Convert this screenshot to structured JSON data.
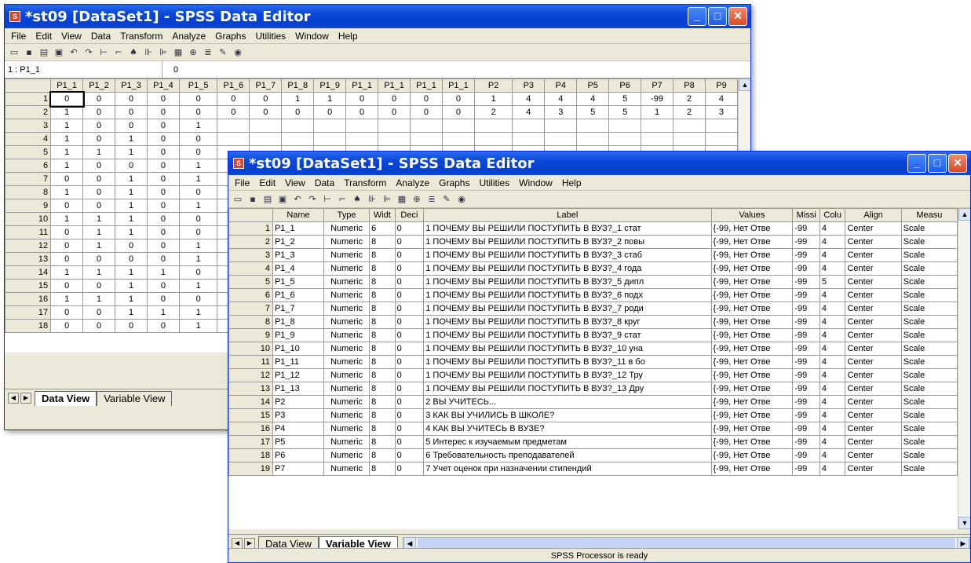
{
  "w1": {
    "title": "*st09 [DataSet1] - SPSS Data Editor",
    "menu": [
      "File",
      "Edit",
      "View",
      "Data",
      "Transform",
      "Analyze",
      "Graphs",
      "Utilities",
      "Window",
      "Help"
    ],
    "cell_ref": "1 : P1_1",
    "cell_value": "0",
    "columns": [
      "P1_1",
      "P1_2",
      "P1_3",
      "P1_4",
      "P1_5",
      "P1_6",
      "P1_7",
      "P1_8",
      "P1_9",
      "P1_1",
      "P1_1",
      "P1_1",
      "P1_1",
      "P2",
      "P3",
      "P4",
      "P5",
      "P6",
      "P7",
      "P8",
      "P9"
    ],
    "rows": [
      [
        "0",
        "0",
        "0",
        "0",
        "0",
        "0",
        "0",
        "1",
        "1",
        "0",
        "0",
        "0",
        "0",
        "1",
        "4",
        "4",
        "4",
        "5",
        "-99",
        "2",
        "4"
      ],
      [
        "1",
        "0",
        "0",
        "0",
        "0",
        "0",
        "0",
        "0",
        "0",
        "0",
        "0",
        "0",
        "0",
        "2",
        "4",
        "3",
        "5",
        "5",
        "1",
        "2",
        "3"
      ],
      [
        "1",
        "0",
        "0",
        "0",
        "1"
      ],
      [
        "1",
        "0",
        "1",
        "0",
        "0"
      ],
      [
        "1",
        "1",
        "1",
        "0",
        "0"
      ],
      [
        "1",
        "0",
        "0",
        "0",
        "1"
      ],
      [
        "0",
        "0",
        "1",
        "0",
        "1"
      ],
      [
        "1",
        "0",
        "1",
        "0",
        "0"
      ],
      [
        "0",
        "0",
        "1",
        "0",
        "1"
      ],
      [
        "1",
        "1",
        "1",
        "0",
        "0"
      ],
      [
        "0",
        "1",
        "1",
        "0",
        "0"
      ],
      [
        "0",
        "1",
        "0",
        "0",
        "1"
      ],
      [
        "0",
        "0",
        "0",
        "0",
        "1"
      ],
      [
        "1",
        "1",
        "1",
        "1",
        "0"
      ],
      [
        "0",
        "0",
        "1",
        "0",
        "1"
      ],
      [
        "1",
        "1",
        "1",
        "0",
        "0"
      ],
      [
        "0",
        "0",
        "1",
        "1",
        "1"
      ],
      [
        "0",
        "0",
        "0",
        "0",
        "1"
      ]
    ],
    "tabs": [
      "Data View",
      "Variable View"
    ]
  },
  "w2": {
    "title": "*st09 [DataSet1] - SPSS Data Editor",
    "menu": [
      "File",
      "Edit",
      "View",
      "Data",
      "Transform",
      "Analyze",
      "Graphs",
      "Utilities",
      "Window",
      "Help"
    ],
    "columns": [
      "Name",
      "Type",
      "Widt",
      "Deci",
      "Label",
      "Values",
      "Missi",
      "Colu",
      "Align",
      "Measu"
    ],
    "rows": [
      [
        "1",
        "P1_1",
        "Numeric",
        "6",
        "0",
        "1 ПОЧЕМУ ВЫ РЕШИЛИ ПОСТУПИТЬ В ВУЗ?_1 стат",
        "{-99, Нет Отве",
        "-99",
        "4",
        "Center",
        "Scale"
      ],
      [
        "2",
        "P1_2",
        "Numeric",
        "8",
        "0",
        "1 ПОЧЕМУ ВЫ РЕШИЛИ ПОСТУПИТЬ В ВУЗ?_2 повы",
        "{-99, Нет Отве",
        "-99",
        "4",
        "Center",
        "Scale"
      ],
      [
        "3",
        "P1_3",
        "Numeric",
        "8",
        "0",
        "1 ПОЧЕМУ ВЫ РЕШИЛИ ПОСТУПИТЬ В ВУЗ?_3 стаб",
        "{-99, Нет Отве",
        "-99",
        "4",
        "Center",
        "Scale"
      ],
      [
        "4",
        "P1_4",
        "Numeric",
        "8",
        "0",
        "1 ПОЧЕМУ ВЫ РЕШИЛИ ПОСТУПИТЬ В ВУЗ?_4 года",
        "{-99, Нет Отве",
        "-99",
        "4",
        "Center",
        "Scale"
      ],
      [
        "5",
        "P1_5",
        "Numeric",
        "8",
        "0",
        "1 ПОЧЕМУ ВЫ РЕШИЛИ ПОСТУПИТЬ В ВУЗ?_5 дипл",
        "{-99, Нет Отве",
        "-99",
        "5",
        "Center",
        "Scale"
      ],
      [
        "6",
        "P1_6",
        "Numeric",
        "8",
        "0",
        "1 ПОЧЕМУ ВЫ РЕШИЛИ ПОСТУПИТЬ В ВУЗ?_6 подх",
        "{-99, Нет Отве",
        "-99",
        "4",
        "Center",
        "Scale"
      ],
      [
        "7",
        "P1_7",
        "Numeric",
        "8",
        "0",
        "1 ПОЧЕМУ ВЫ РЕШИЛИ ПОСТУПИТЬ В ВУЗ?_7 роди",
        "{-99, Нет Отве",
        "-99",
        "4",
        "Center",
        "Scale"
      ],
      [
        "8",
        "P1_8",
        "Numeric",
        "8",
        "0",
        "1 ПОЧЕМУ ВЫ РЕШИЛИ ПОСТУПИТЬ В ВУЗ?_8 круг",
        "{-99, Нет Отве",
        "-99",
        "4",
        "Center",
        "Scale"
      ],
      [
        "9",
        "P1_9",
        "Numeric",
        "8",
        "0",
        "1 ПОЧЕМУ ВЫ РЕШИЛИ ПОСТУПИТЬ В ВУЗ?_9 стат",
        "{-99, Нет Отве",
        "-99",
        "4",
        "Center",
        "Scale"
      ],
      [
        "10",
        "P1_10",
        "Numeric",
        "8",
        "0",
        "1 ПОЧЕМУ ВЫ РЕШИЛИ ПОСТУПИТЬ В ВУЗ?_10 уна",
        "{-99, Нет Отве",
        "-99",
        "4",
        "Center",
        "Scale"
      ],
      [
        "11",
        "P1_11",
        "Numeric",
        "8",
        "0",
        "1 ПОЧЕМУ ВЫ РЕШИЛИ ПОСТУПИТЬ В ВУЗ?_11 в бо",
        "{-99, Нет Отве",
        "-99",
        "4",
        "Center",
        "Scale"
      ],
      [
        "12",
        "P1_12",
        "Numeric",
        "8",
        "0",
        "1 ПОЧЕМУ ВЫ РЕШИЛИ ПОСТУПИТЬ В ВУЗ?_12 Тру",
        "{-99, Нет Отве",
        "-99",
        "4",
        "Center",
        "Scale"
      ],
      [
        "13",
        "P1_13",
        "Numeric",
        "8",
        "0",
        "1 ПОЧЕМУ ВЫ РЕШИЛИ ПОСТУПИТЬ В ВУЗ?_13 Дру",
        "{-99, Нет Отве",
        "-99",
        "4",
        "Center",
        "Scale"
      ],
      [
        "14",
        "P2",
        "Numeric",
        "8",
        "0",
        "2 ВЫ УЧИТЕСЬ...",
        "{-99, Нет Отве",
        "-99",
        "4",
        "Center",
        "Scale"
      ],
      [
        "15",
        "P3",
        "Numeric",
        "8",
        "0",
        "3 КАК ВЫ УЧИЛИСЬ В ШКОЛЕ?",
        "{-99, Нет Отве",
        "-99",
        "4",
        "Center",
        "Scale"
      ],
      [
        "16",
        "P4",
        "Numeric",
        "8",
        "0",
        "4 КАК ВЫ УЧИТЕСЬ В ВУЗЕ?",
        "{-99, Нет Отве",
        "-99",
        "4",
        "Center",
        "Scale"
      ],
      [
        "17",
        "P5",
        "Numeric",
        "8",
        "0",
        "5 Интерес к изучаемым предметам",
        "{-99, Нет Отве",
        "-99",
        "4",
        "Center",
        "Scale"
      ],
      [
        "18",
        "P6",
        "Numeric",
        "8",
        "0",
        "6 Требовательность преподавателей",
        "{-99, Нет Отве",
        "-99",
        "4",
        "Center",
        "Scale"
      ],
      [
        "19",
        "P7",
        "Numeric",
        "8",
        "0",
        "7 Учет оценок при назначении стипендий",
        "{-99, Нет Отве",
        "-99",
        "4",
        "Center",
        "Scale"
      ]
    ],
    "tabs": [
      "Data View",
      "Variable View"
    ],
    "status": "SPSS Processor is ready"
  },
  "toolbar_icons": [
    "open-icon",
    "save-icon",
    "print-icon",
    "dialog-recall-icon",
    "undo-icon",
    "redo-icon",
    "goto-case-icon",
    "variables-icon",
    "find-icon",
    "insert-cases-icon",
    "insert-variable-icon",
    "split-file-icon",
    "weight-cases-icon",
    "select-cases-icon",
    "value-labels-icon",
    "use-sets-icon"
  ],
  "toolbar_glyphs": [
    "▭",
    "▪",
    "▤",
    "▣",
    "↶",
    "↷",
    "⊢",
    "⌐",
    "♠",
    "⊪",
    "⊫",
    "▦",
    "⊕",
    "≣",
    "✎",
    "◉"
  ]
}
